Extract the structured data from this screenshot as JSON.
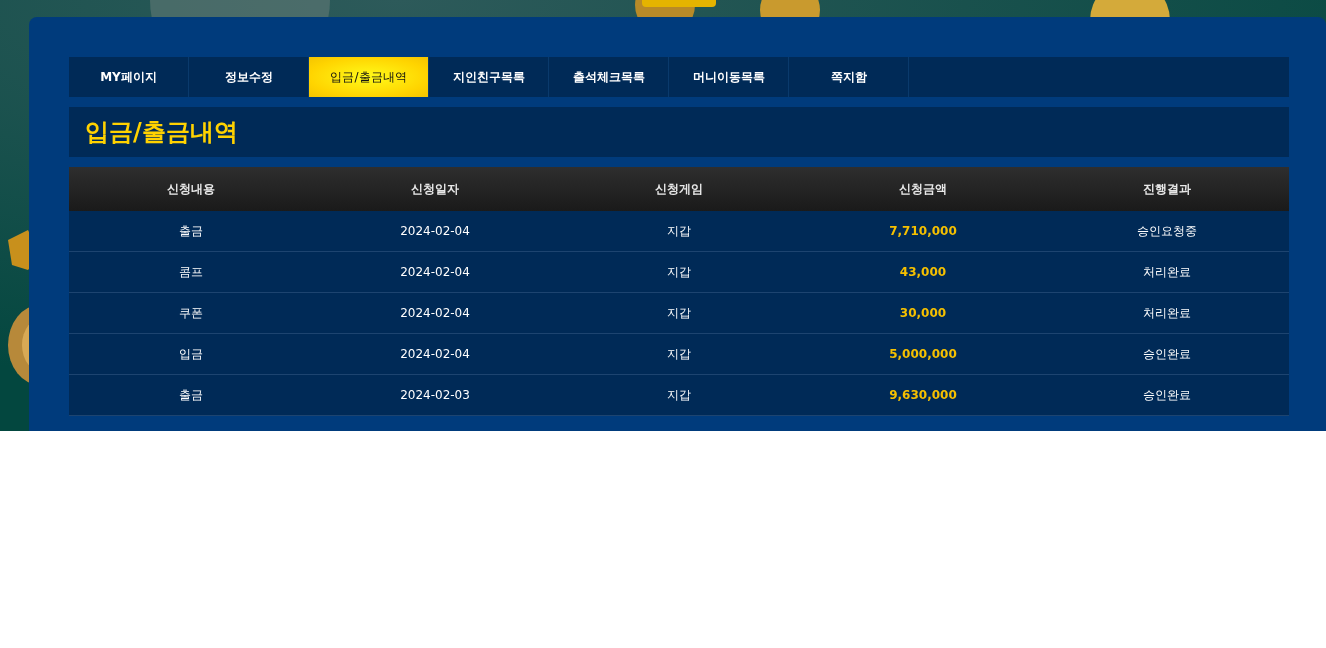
{
  "tabs": [
    {
      "label": "MY페이지",
      "selected": false
    },
    {
      "label": "정보수정",
      "selected": false
    },
    {
      "label": "입금/출금내역",
      "selected": true
    },
    {
      "label": "지인친구목록",
      "selected": false
    },
    {
      "label": "출석체크목록",
      "selected": false
    },
    {
      "label": "머니이동목록",
      "selected": false
    },
    {
      "label": "쪽지함",
      "selected": false
    }
  ],
  "page_title": "입금/출금내역",
  "table": {
    "columns": [
      "신청내용",
      "신청일자",
      "신청게임",
      "신청금액",
      "진행결과"
    ],
    "rows": [
      [
        "출금",
        "2024-02-04",
        "지갑",
        "7,710,000",
        "승인요청중"
      ],
      [
        "콤프",
        "2024-02-04",
        "지갑",
        "43,000",
        "처리완료"
      ],
      [
        "쿠폰",
        "2024-02-04",
        "지갑",
        "30,000",
        "처리완료"
      ],
      [
        "입금",
        "2024-02-04",
        "지갑",
        "5,000,000",
        "승인완료"
      ],
      [
        "출금",
        "2024-02-03",
        "지갑",
        "9,630,000",
        "승인완료"
      ]
    ]
  }
}
